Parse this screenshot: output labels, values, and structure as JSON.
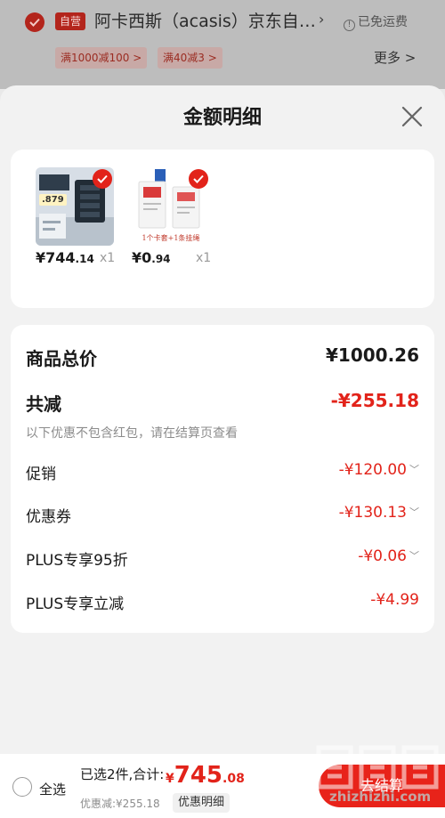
{
  "store": {
    "self_operated_tag": "自营",
    "name": "阿卡西斯（acasis）京东自营旗舰店",
    "free_shipping": "已免运费",
    "coupons": [
      "满1000减100 >",
      "满40减3 >"
    ],
    "more": "更多 >"
  },
  "sheet": {
    "title": "金额明细"
  },
  "products": [
    {
      "badge": ".879",
      "price_int": "¥744",
      "price_dec": ".14",
      "qty": "x1"
    },
    {
      "caption": "1个卡套+1条挂绳",
      "price_int": "¥0",
      "price_dec": ".94",
      "qty": "x1"
    }
  ],
  "breakdown": {
    "subtotal_label": "商品总价",
    "subtotal_value": "¥1000.26",
    "reduce_label": "共减",
    "reduce_value": "-¥255.18",
    "reduce_note": "以下优惠不包含红包，请在结算页查看",
    "items": [
      {
        "label": "促销",
        "value": "-¥120.00"
      },
      {
        "label": "优惠券",
        "value": "-¥130.13"
      },
      {
        "label": "PLUS专享95折",
        "value": "-¥0.06"
      },
      {
        "label": "PLUS专享立减",
        "value": "-¥4.99"
      }
    ]
  },
  "bottom_bar": {
    "select_all": "全选",
    "selected_summary": "已选2件,合计:",
    "total_cur": "¥",
    "total_int": "745",
    "total_dec": ".08",
    "saved": "优惠减:¥255.18",
    "detail_button": "优惠明细",
    "checkout_button": "去结算"
  },
  "watermark": {
    "url": "zhizhizhi.com"
  },
  "colors": {
    "accent_red": "#e2231a",
    "sheet_bg": "#f2f2f2"
  }
}
